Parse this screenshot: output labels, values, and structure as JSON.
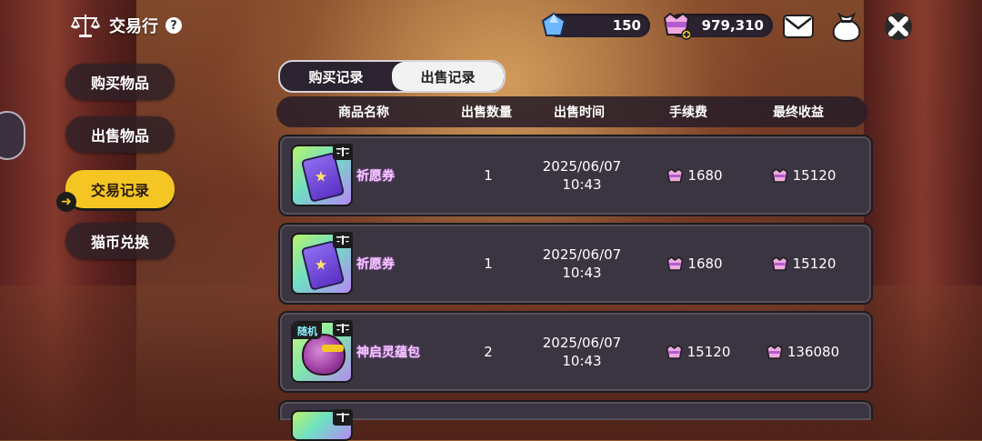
{
  "header": {
    "title": "交易行",
    "help": "?"
  },
  "currency": {
    "gem": "150",
    "coin": "979,310"
  },
  "nav": [
    {
      "label": "购买物品"
    },
    {
      "label": "出售物品"
    },
    {
      "label": "交易记录",
      "active": true
    },
    {
      "label": "猫币兑换"
    }
  ],
  "tabs": [
    {
      "label": "购买记录"
    },
    {
      "label": "出售记录",
      "active": true
    }
  ],
  "table": {
    "headers": [
      "商品名称",
      "出售数量",
      "出售时间",
      "手续费",
      "最终收益"
    ],
    "rows": [
      {
        "name": "祈愿券",
        "qty": "1",
        "date": "2025/06/07",
        "time": "10:43",
        "fee": "1680",
        "income": "15120"
      },
      {
        "name": "祈愿券",
        "qty": "1",
        "date": "2025/06/07",
        "time": "10:43",
        "fee": "1680",
        "income": "15120"
      },
      {
        "name": "神启灵蕴包",
        "tag": "随机",
        "qty": "2",
        "date": "2025/06/07",
        "time": "10:43",
        "fee": "15120",
        "income": "136080"
      }
    ]
  },
  "colors": {
    "accent": "#f5c623",
    "row_bg": "#3a3540"
  }
}
